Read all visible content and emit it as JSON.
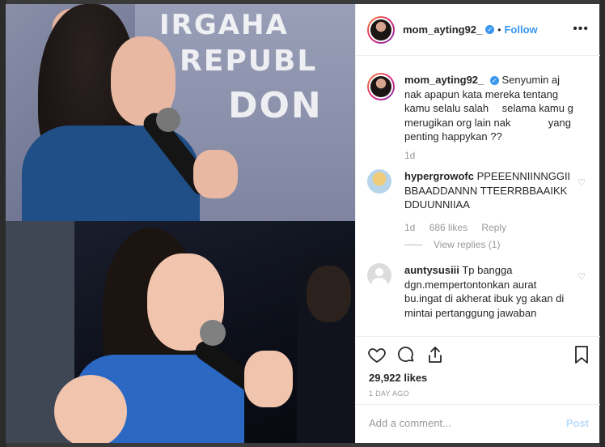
{
  "header": {
    "username": "mom_ayting92_",
    "separator": "•",
    "follow_label": "Follow",
    "more_label": "•••"
  },
  "caption": {
    "username": "mom_ayting92_",
    "text": "Senyumin aj nak apapun kata mereka tentang kamu selalu salah  selama kamu g merugikan org lain nak     yang penting happykan ??",
    "age": "1d"
  },
  "comments": [
    {
      "username": "hypergrowofc",
      "text": "PPEEENNIINNGGII BBAADDANNN TTEERRBBAAIKK DDUUNNIIAA    ",
      "age": "1d",
      "likes": "686 likes",
      "reply_label": "Reply",
      "view_replies": "View replies (1)"
    },
    {
      "username": "auntysusiii",
      "text": "Tp bangga dgn.mempertontonkan aurat bu.ingat di akherat ibuk yg akan di mintai pertanggung jawaban"
    }
  ],
  "post": {
    "likes": "29,922 likes",
    "time": "1 DAY AGO"
  },
  "add_comment": {
    "placeholder": "Add a comment...",
    "post_label": "Post"
  },
  "photo": {
    "banner_line1": "IRGAHA",
    "banner_line2": "REPUBL",
    "banner_line3": "DON"
  },
  "colors": {
    "accent": "#3897f0",
    "post_disabled": "#b9dcfb",
    "text": "#262626",
    "muted": "#999999"
  }
}
